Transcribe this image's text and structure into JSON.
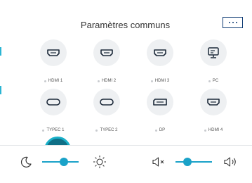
{
  "title": "Paramètres communs",
  "sources": [
    {
      "label": "HDMI 1",
      "icon": "hdmi-icon"
    },
    {
      "label": "HDMI 2",
      "icon": "hdmi-icon"
    },
    {
      "label": "HDMI 3",
      "icon": "hdmi-icon"
    },
    {
      "label": "PC",
      "icon": "monitor-icon"
    },
    {
      "label": "TYPEC 1",
      "icon": "usb-c-icon"
    },
    {
      "label": "TYPEC 2",
      "icon": "usb-c-icon"
    },
    {
      "label": "DP",
      "icon": "displayport-icon"
    },
    {
      "label": "HDMI 4",
      "icon": "hdmi-icon"
    }
  ],
  "brightness": {
    "min_icon": "moon-icon",
    "max_icon": "sun-icon",
    "level_fraction": 0.6
  },
  "volume": {
    "mute_icon": "speaker-mute-icon",
    "max_icon": "speaker-loud-icon",
    "level_fraction": 0.3
  },
  "colors": {
    "accent": "#1aa2c8",
    "more_border": "#0e3a73"
  }
}
